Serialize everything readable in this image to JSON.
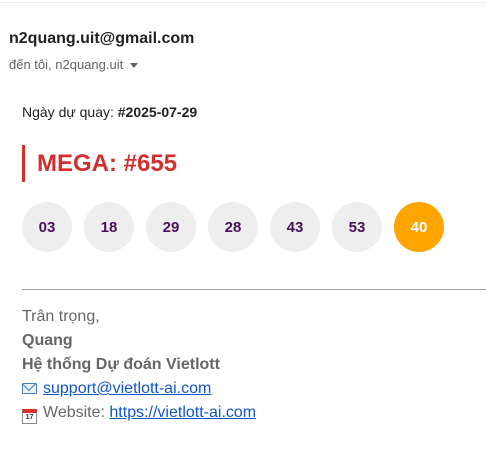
{
  "email": {
    "sender": "n2quang.uit@gmail.com",
    "recipients": "đến tôi, n2quang.uit"
  },
  "draw": {
    "date_label": "Ngày dự quay: ",
    "date_value": "#2025-07-29",
    "product_title": "MEGA: #655",
    "numbers": [
      "03",
      "18",
      "29",
      "28",
      "43",
      "53"
    ],
    "special_number": "40",
    "colors": {
      "accent": "#d32f2f",
      "ball_bg": "#eeeeee",
      "ball_text": "#4a0f5a",
      "special_ball_bg": "#ffa400"
    }
  },
  "signature": {
    "greeting": "Trân trọng,",
    "name": "Quang",
    "org": "Hệ thống Dự đoán Vietlott",
    "email_icon": "envelope-icon",
    "email_link": "support@vietlott-ai.com",
    "website_icon": "calendar-icon",
    "calendar_day": "17",
    "website_label": "Website: ",
    "website_link": "https://vietlott-ai.com"
  }
}
